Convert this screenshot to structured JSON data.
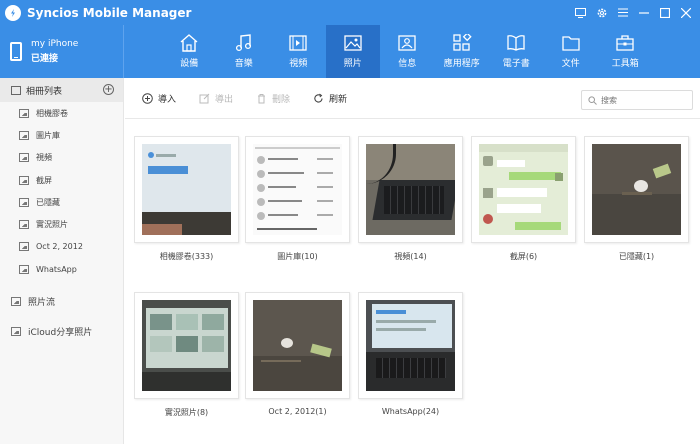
{
  "app": {
    "title": "Syncios Mobile Manager"
  },
  "window_controls": [
    "monitor-icon",
    "gear-icon",
    "menu-icon",
    "minimize-icon",
    "maximize-icon",
    "close-icon"
  ],
  "device": {
    "name": "my iPhone",
    "status": "已連接"
  },
  "tabs": [
    {
      "label": "設備",
      "icon": "home-icon"
    },
    {
      "label": "音樂",
      "icon": "music-icon"
    },
    {
      "label": "視頻",
      "icon": "video-icon"
    },
    {
      "label": "照片",
      "icon": "photo-icon",
      "active": true
    },
    {
      "label": "信息",
      "icon": "contact-card-icon"
    },
    {
      "label": "應用程序",
      "icon": "apps-icon"
    },
    {
      "label": "電子書",
      "icon": "book-icon"
    },
    {
      "label": "文件",
      "icon": "folder-icon"
    },
    {
      "label": "工具箱",
      "icon": "toolbox-icon"
    }
  ],
  "sidebar": {
    "header": "相冊列表",
    "albums": [
      "相機膠卷",
      "圖片庫",
      "視頻",
      "截屏",
      "已隱藏",
      "實況照片",
      "Oct 2, 2012",
      "WhatsApp"
    ],
    "photo_stream": "照片流",
    "icloud": "iCloud分享照片"
  },
  "toolbar": {
    "import": "導入",
    "export": "導出",
    "delete": "刪除",
    "refresh": "刷新",
    "search_placeholder": "搜索"
  },
  "grid": {
    "albums": [
      {
        "label": "相機膠卷(333)"
      },
      {
        "label": "圖片庫(10)"
      },
      {
        "label": "視頻(14)"
      },
      {
        "label": "截屏(6)"
      },
      {
        "label": "已隱藏(1)"
      },
      {
        "label": "實況照片(8)"
      },
      {
        "label": "Oct 2, 2012(1)"
      },
      {
        "label": "WhatsApp(24)"
      }
    ]
  },
  "colors": {
    "accent": "#3a8ee6",
    "active_tab": "#2870c8"
  }
}
